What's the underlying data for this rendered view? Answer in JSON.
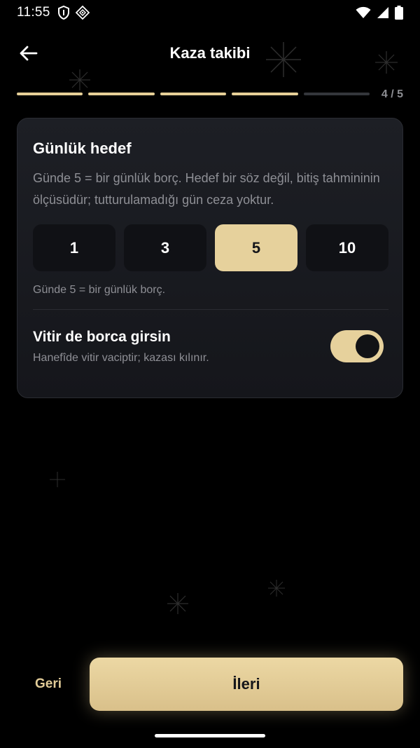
{
  "status_bar": {
    "time": "11:55",
    "left_icons": [
      "shield-icon",
      "app-notification-icon"
    ],
    "right_icons": [
      "wifi-icon",
      "signal-icon",
      "battery-icon"
    ]
  },
  "header": {
    "title": "Kaza takibi",
    "back_icon": "arrow-left-icon"
  },
  "progress": {
    "current_step": 4,
    "total_steps": 5,
    "counter_text": "4 / 5",
    "done_color": "#e6cf97",
    "pending_color": "#34363b"
  },
  "card": {
    "title": "Günlük hedef",
    "description": "Günde 5 = bir günlük borç. Hedef bir söz değil, bitiş tahmininin ölçüsüdür; tutturulamadığı gün ceza yoktur.",
    "options": [
      {
        "label": "1",
        "selected": false
      },
      {
        "label": "3",
        "selected": false
      },
      {
        "label": "5",
        "selected": true
      },
      {
        "label": "10",
        "selected": false
      }
    ],
    "helper": "Günde 5 = bir günlük borç.",
    "vitir_toggle": {
      "title": "Vitir de borca girsin",
      "subtitle": "Hanefîde vitir vaciptir; kazası kılınır.",
      "on": true
    }
  },
  "footer": {
    "back_label": "Geri",
    "next_label": "İleri"
  },
  "colors": {
    "accent": "#e6d19c",
    "background": "#000000",
    "card": "#1a1c21",
    "muted_text": "#8e8f95"
  }
}
